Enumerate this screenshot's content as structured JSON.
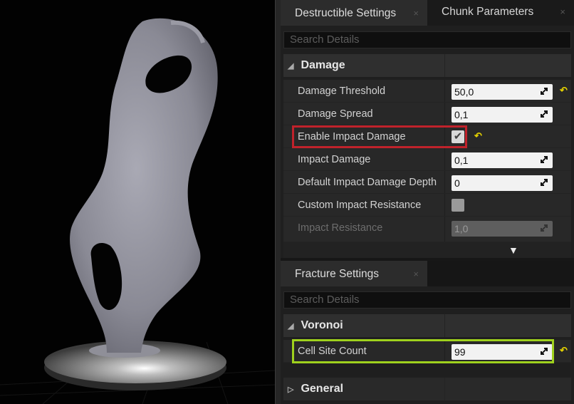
{
  "top_panel": {
    "tabs": [
      {
        "label": "Destructible Settings",
        "close": "×"
      },
      {
        "label": "Chunk Parameters",
        "close": "×"
      }
    ],
    "search_placeholder": "Search Details",
    "category": {
      "arrow": "◢",
      "label": "Damage"
    },
    "properties": [
      {
        "label": "Damage Threshold",
        "value": "50,0"
      },
      {
        "label": "Damage Spread",
        "value": "0,1"
      },
      {
        "label": "Enable Impact Damage",
        "checked": true
      },
      {
        "label": "Impact Damage",
        "value": "0,1"
      },
      {
        "label": "Default Impact Damage Depth",
        "value": "0"
      },
      {
        "label": "Custom Impact Resistance",
        "checked": false
      },
      {
        "label": "Impact Resistance",
        "value": "1,0",
        "disabled": true
      }
    ],
    "reset_icon": "↶",
    "check_glyph": "✔",
    "expander_glyph": "▼"
  },
  "bottom_panel": {
    "tab": {
      "label": "Fracture Settings",
      "close": "×"
    },
    "search_placeholder": "Search Details",
    "category": {
      "arrow": "◢",
      "label": "Voronoi"
    },
    "properties": [
      {
        "label": "Cell Site Count",
        "value": "99"
      }
    ],
    "general_category": {
      "arrow": "▷",
      "label": "General"
    }
  },
  "colors": {
    "highlight_red": "#c0222b",
    "highlight_green": "#9fd11d",
    "reset_yellow": "#e4d100"
  }
}
